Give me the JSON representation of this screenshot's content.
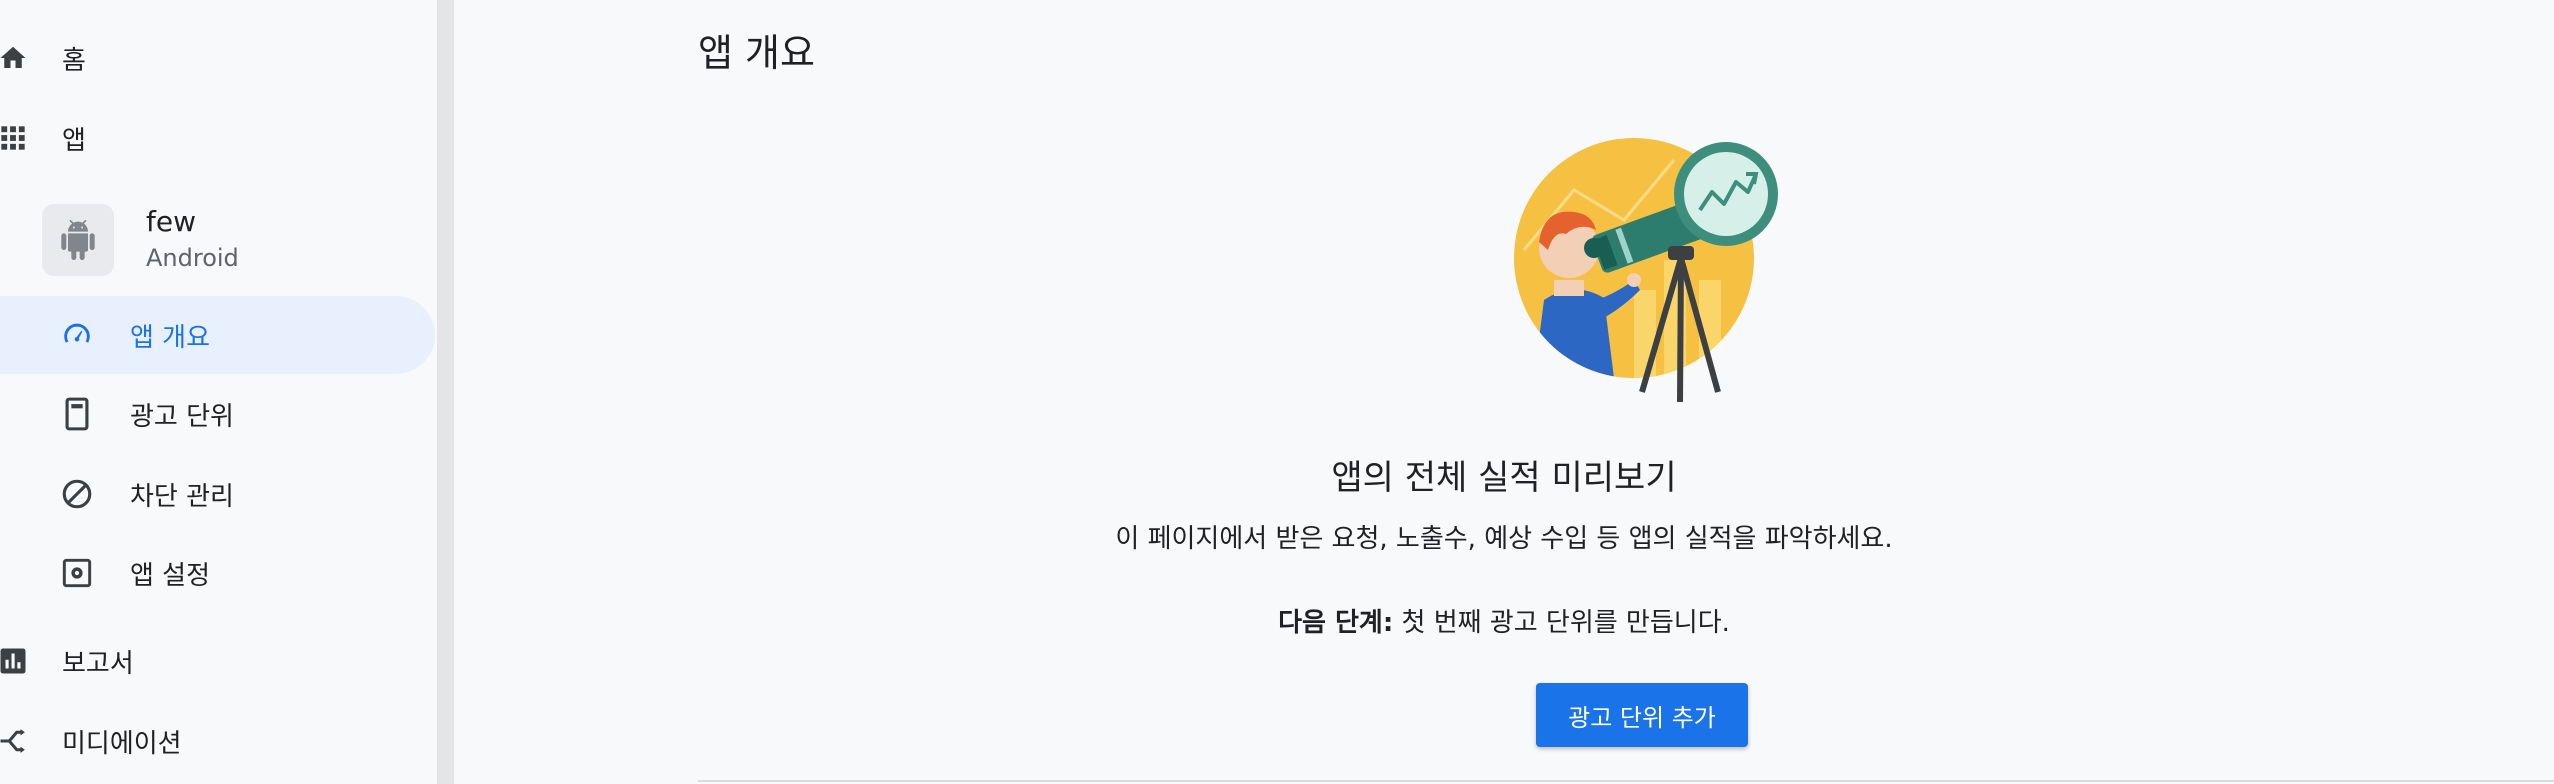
{
  "sidebar": {
    "home_label": "홈",
    "apps_label": "앱",
    "app": {
      "name": "few",
      "platform": "Android"
    },
    "app_items": [
      {
        "label": "앱 개요",
        "icon": "gauge-icon",
        "active": true
      },
      {
        "label": "광고 단위",
        "icon": "ad-unit-icon"
      },
      {
        "label": "차단 관리",
        "icon": "block-icon"
      },
      {
        "label": "앱 설정",
        "icon": "settings-icon"
      }
    ],
    "reports_label": "보고서",
    "mediation_label": "미디에이션"
  },
  "main": {
    "page_title": "앱 개요",
    "heading": "앱의 전체 실적 미리보기",
    "subtext": "이 페이지에서 받은 요청, 노출수, 예상 수입 등 앱의 실적을 파악하세요.",
    "next_step_bold": "다음 단계:",
    "next_step_text": " 첫 번째 광고 단위를 만듭니다.",
    "cta_label": "광고 단위 추가"
  },
  "colors": {
    "accent": "#1a73e8",
    "active_bg": "#e8f0fe",
    "illustration_yellow": "#f6c143",
    "illustration_teal": "#3e8e7e"
  }
}
